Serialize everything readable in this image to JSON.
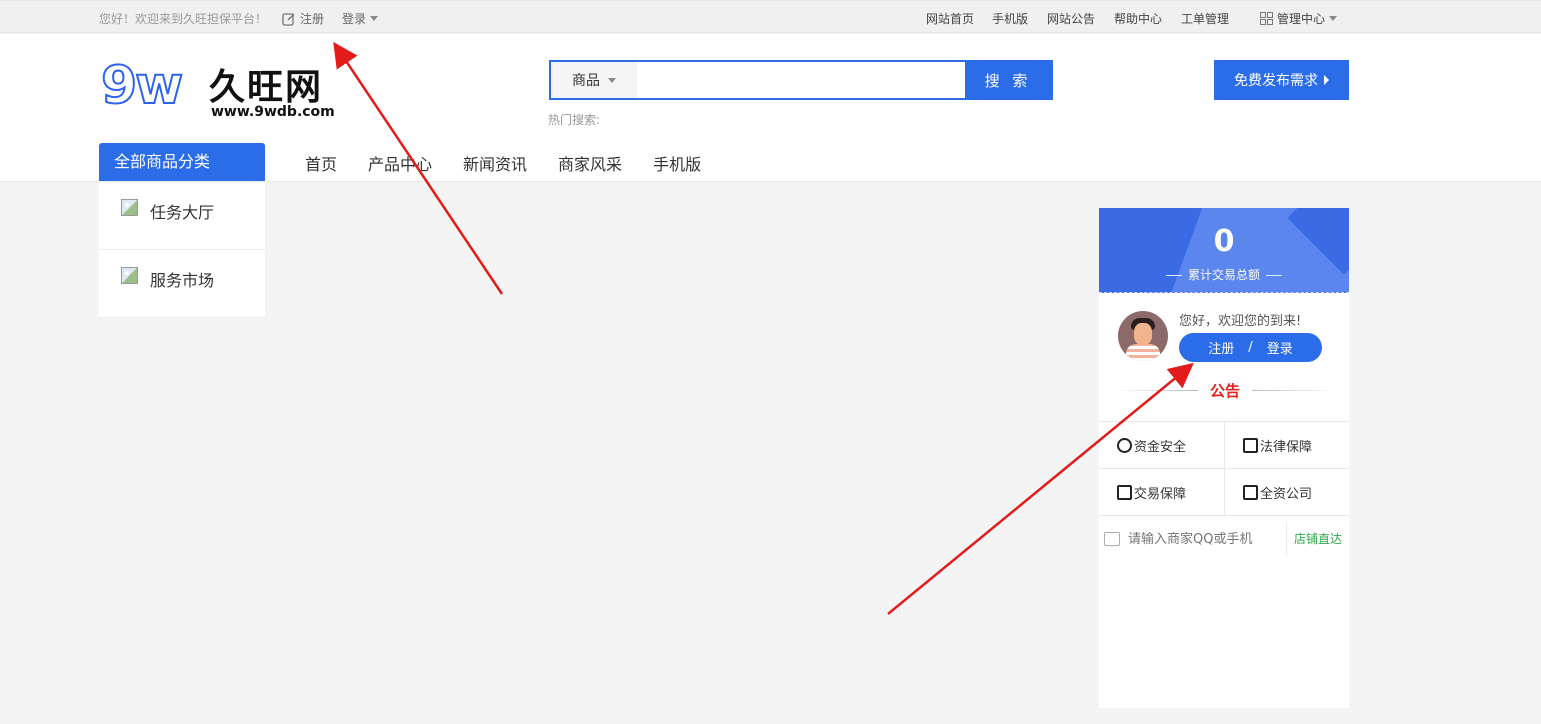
{
  "topbar": {
    "welcome": "您好！欢迎来到久旺担保平台！",
    "register": "注册",
    "login": "登录",
    "links": [
      "网站首页",
      "手机版",
      "网站公告",
      "帮助中心",
      "工单管理"
    ],
    "manage": "管理中心"
  },
  "logo": {
    "mark": "9w",
    "name": "久旺网",
    "url": "www.9wdb.com"
  },
  "search": {
    "category": "商品",
    "placeholder": "",
    "button": "搜 索",
    "hot_label": "热门搜索:"
  },
  "publish_button": "免费发布需求",
  "all_categories": "全部商品分类",
  "nav": [
    "首页",
    "产品中心",
    "新闻资讯",
    "商家风采",
    "手机版"
  ],
  "categories": [
    "任务大厅",
    "服务市场"
  ],
  "panel": {
    "total_value": "0",
    "total_label": "累计交易总额",
    "greeting": "您好，欢迎您的到来!",
    "register": "注册",
    "separator": "/",
    "login": "登录",
    "notice": "公告",
    "features": [
      [
        "资金安全",
        "法律保障"
      ],
      [
        "交易保障",
        "全资公司"
      ]
    ],
    "shop_placeholder": "请输入商家QQ或手机",
    "shop_go": "店铺直达"
  },
  "colors": {
    "primary": "#2b6ce8",
    "notice": "#e52222",
    "annotation": "#e31b1b"
  }
}
